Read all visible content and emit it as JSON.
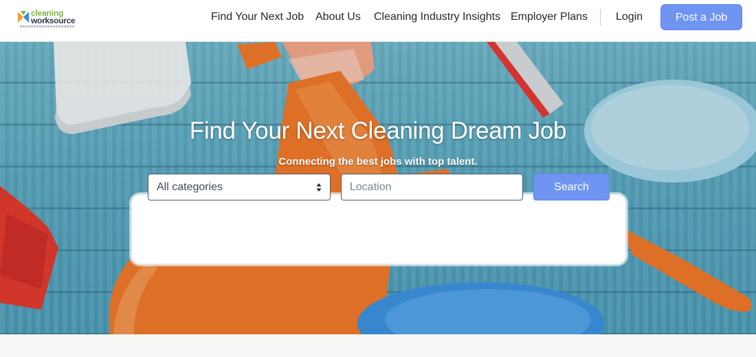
{
  "header": {
    "logo": {
      "line1": "cleaning",
      "line2": "worksource"
    },
    "nav": [
      {
        "label": "Find Your Next Job"
      },
      {
        "label": "About Us"
      },
      {
        "label": "Cleaning Industry Insights"
      },
      {
        "label": "Employer Plans"
      },
      {
        "label": "Login"
      }
    ],
    "post_button": "Post a Job"
  },
  "hero": {
    "title": "Find Your Next Cleaning Dream Job",
    "subtitle": "Connecting the best jobs with top talent."
  },
  "search": {
    "category_selected": "All categories",
    "location_placeholder": "Location",
    "location_value": "",
    "button": "Search"
  },
  "colors": {
    "accent": "#6f94f2",
    "logo_green": "#7cb342",
    "logo_dark": "#2b3a4a"
  },
  "icons": {
    "logo_mark": "cleaning-worksource-logo-mark",
    "select_arrows": "select-updown-arrows-icon"
  }
}
